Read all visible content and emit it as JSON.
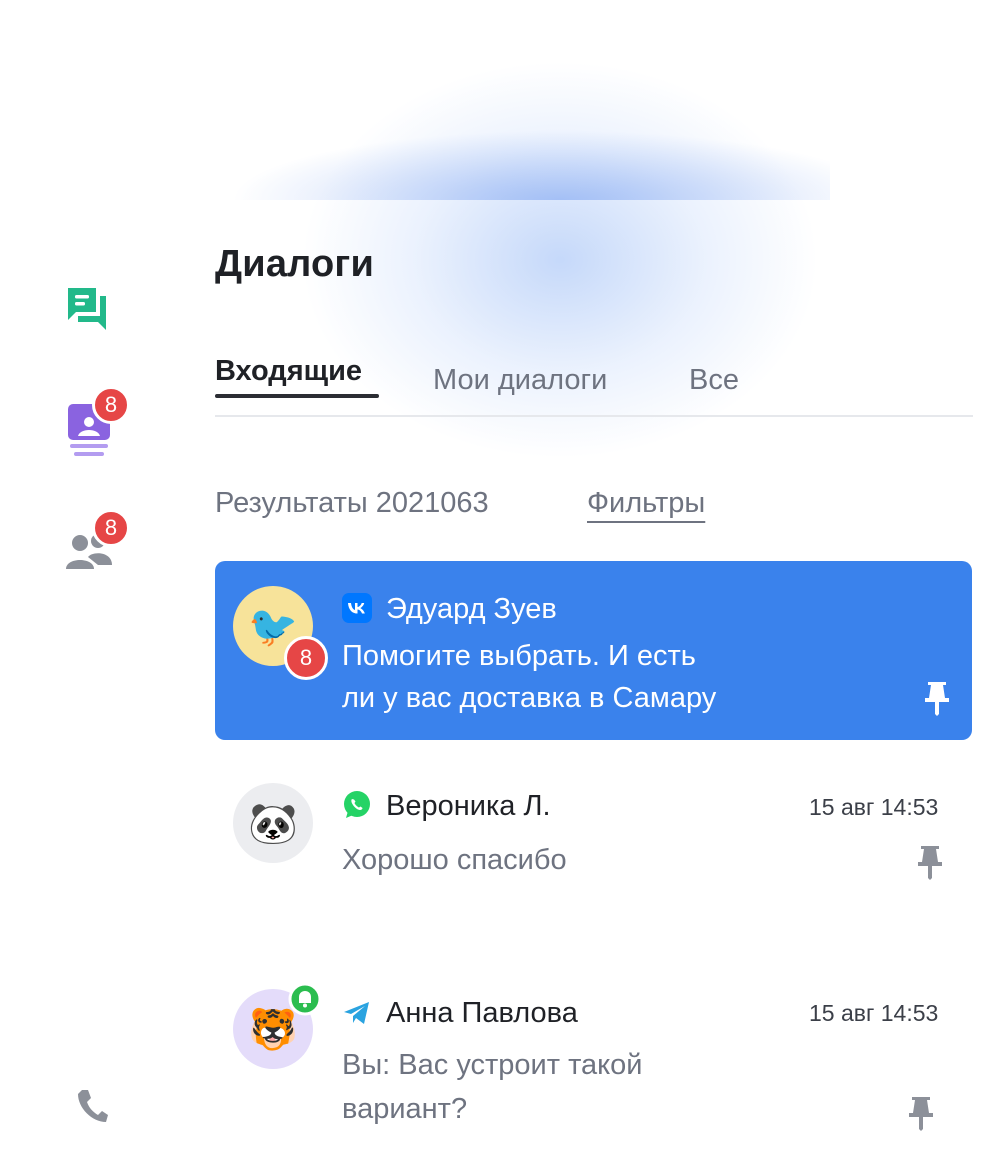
{
  "sidebar": {
    "items": [
      {
        "icon": "dialogs-icon",
        "color": "#22b98a"
      },
      {
        "icon": "queue-icon",
        "color": "#8a63e0",
        "badge": "8"
      },
      {
        "icon": "contacts-icon",
        "color": "#8c9099",
        "badge": "8"
      }
    ],
    "bottom_icon": "phone-icon"
  },
  "page_title": "Диалоги",
  "tabs": [
    {
      "label": "Входящие",
      "active": true
    },
    {
      "label": "Мои диалоги",
      "active": false
    },
    {
      "label": "Все",
      "active": false
    }
  ],
  "results_label": "Результаты 2021063",
  "filters_label": "Фильтры",
  "dialogs": [
    {
      "name": "Эдуард Зуев",
      "channel": "vk-icon",
      "avatar": "bird-avatar",
      "avatar_emoji": "🐦",
      "unread": "8",
      "message_line1": "Помогите выбрать. И есть",
      "message_line2": "ли у вас доставка в Самару",
      "active": true
    },
    {
      "name": "Вероника Л.",
      "channel": "whatsapp-icon",
      "avatar": "panda-avatar",
      "avatar_emoji": "🐼",
      "time": "15 авг 14:53",
      "message_line1": "Хорошо спасибо"
    },
    {
      "name": "Анна Павлова",
      "channel": "telegram-icon",
      "avatar": "tiger-avatar",
      "avatar_emoji": "🐯",
      "time": "15 авг 14:53",
      "message_line1": "Вы: Вас устроит такой",
      "message_line2": "вариант?"
    }
  ],
  "colors": {
    "accent": "#3a82ec",
    "badge": "#e64646",
    "muted_text": "#6e7380"
  }
}
